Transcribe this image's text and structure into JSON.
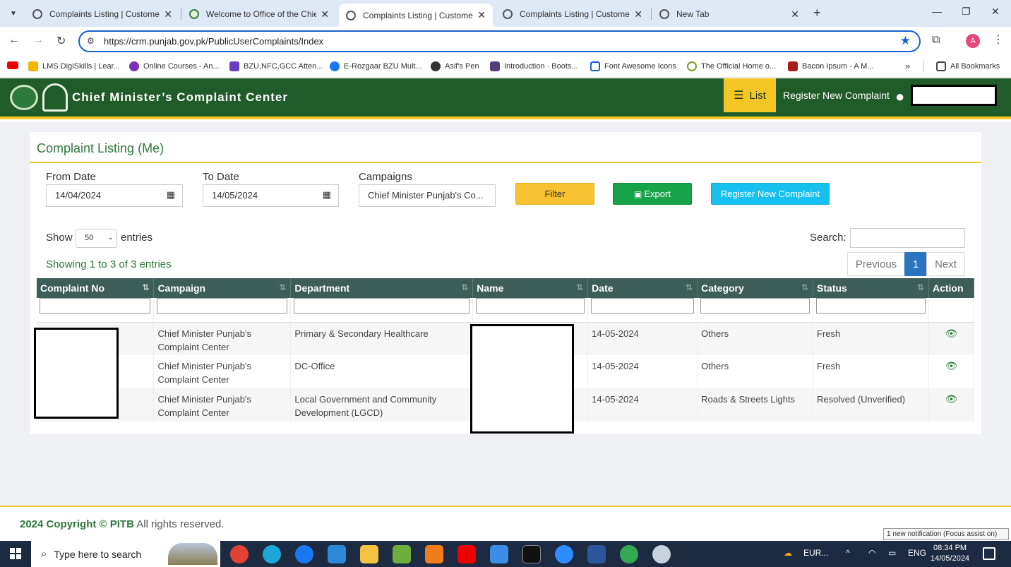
{
  "browser": {
    "tabs": [
      {
        "title": "Complaints Listing | Customer F"
      },
      {
        "title": "Welcome to Office of the Chief"
      },
      {
        "title": "Complaints Listing | Customer F"
      },
      {
        "title": "Complaints Listing | Customer F"
      },
      {
        "title": "New Tab"
      }
    ],
    "url": "https://crm.punjab.gov.pk/PublicUserComplaints/Index",
    "profile_initial": "A",
    "bookmarks": [
      "LMS DigiSkills | Lear...",
      "Online Courses - An...",
      "BZU,NFC,GCC Atten...",
      "E-Rozgaar BZU Mult...",
      "Asif's Pen",
      "Introduction · Boots...",
      "Font Awesome Icons",
      "The Official Home o...",
      "Bacon Ipsum - A M..."
    ],
    "all_bookmarks": "All Bookmarks"
  },
  "header": {
    "title": "Chief Minister’s Complaint Center",
    "list_label": "List",
    "register_label": "Register New Complaint"
  },
  "panel": {
    "title": "Complaint Listing (Me)",
    "from_date_label": "From Date",
    "from_date_value": "14/04/2024",
    "to_date_label": "To Date",
    "to_date_value": "14/05/2024",
    "campaigns_label": "Campaigns",
    "campaigns_value": "Chief Minister Punjab's Co...",
    "filter_label": "Filter",
    "export_label": "Export",
    "register_label": "Register New Complaint"
  },
  "table_controls": {
    "show_label": "Show",
    "entries_value": "50",
    "entries_label": "entries",
    "search_label": "Search:",
    "info": "Showing 1 to 3 of 3 entries",
    "previous": "Previous",
    "page": "1",
    "next": "Next"
  },
  "table": {
    "columns": [
      "Complaint No",
      "Campaign",
      "Department",
      "Name",
      "Date",
      "Category",
      "Status",
      "Action"
    ],
    "rows": [
      {
        "complaint_no": "",
        "campaign": "Chief Minister Punjab's Complaint Center",
        "department": "Primary & Secondary Healthcare",
        "name": "",
        "date": "14-05-2024",
        "category": "Others",
        "status": "Fresh"
      },
      {
        "complaint_no": "",
        "campaign": "Chief Minister Punjab's Complaint Center",
        "department": "DC-Office",
        "name": "",
        "date": "14-05-2024",
        "category": "Others",
        "status": "Fresh"
      },
      {
        "complaint_no": "",
        "campaign": "Chief Minister Punjab's Complaint Center",
        "department": "Local Government and Community Development (LGCD)",
        "name": "",
        "date": "14-05-2024",
        "category": "Roads & Streets Lights",
        "status": "Resolved (Unverified)"
      }
    ]
  },
  "footer": {
    "copyright_bold": "2024 Copyright © PITB",
    "copyright_rest": " All rights reserved."
  },
  "notification_tip": "1 new notification (Focus assist on)",
  "taskbar": {
    "search_placeholder": "Type here to search",
    "weather": "EUR...",
    "language": "ENG",
    "time": "08:34 PM",
    "date": "14/05/2024"
  },
  "colors": {
    "header_green": "#1f5c2a",
    "accent_yellow": "#f3c623",
    "table_header": "#3d5d58",
    "export_green": "#16a34a",
    "register_cyan": "#17c1ef"
  }
}
